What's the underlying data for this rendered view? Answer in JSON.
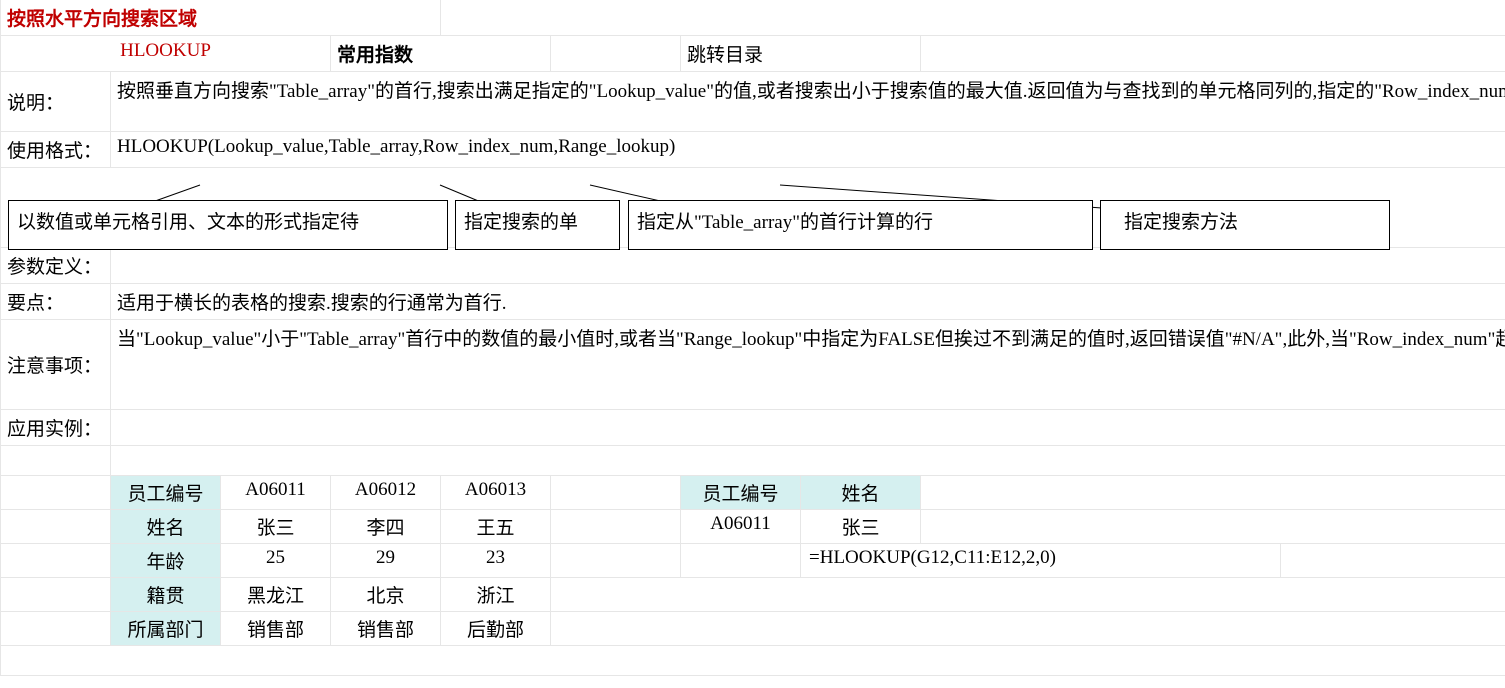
{
  "title": "按照水平方向搜索区域",
  "function_name": "HLOOKUP",
  "freq_label": "常用指数",
  "nav_link": "跳转目录",
  "labels": {
    "desc": "说明：",
    "usage": "使用格式：",
    "params": "参数定义：",
    "points": "要点：",
    "notes": "注意事项：",
    "example": "应用实例："
  },
  "description": "按照垂直方向搜索\"Table_array\"的首行,搜索出满足指定的\"Lookup_value\"的值,或者搜索出小于搜索值的最大值.返回值为与查找到的单元格同列的,指定的\"Row_index_num\"(行序号)下移的单元格的值.",
  "usage_formula": "HLOOKUP(Lookup_value,Table_array,Row_index_num,Range_lookup)",
  "tooltips": {
    "t1": "以数值或单元格引用、文本的形式指定待",
    "t2": "指定搜索的单",
    "t3": "指定从\"Table_array\"的首行计算的行",
    "t4": "指定搜索方法"
  },
  "points_text": "适用于横长的表格的搜索.搜索的行通常为首行.",
  "notes_text": "当\"Lookup_value\"小于\"Table_array\"首行中的数值的最小值时,或者当\"Range_lookup\"中指定为FALSE但挨过不到满足的值时,返回错误值\"#N/A\",此外,当\"Row_index_num\"超出搜索区域的行数时返回错误值\"#REF!\".当\"Row_index_num\"小于1时返回错误值\"#VALUE!\".使用函数时要注意确认参数是否正确.",
  "example_table": {
    "row_headers": [
      "员工编号",
      "姓名",
      "年龄",
      "籍贯",
      "所属部门"
    ],
    "cols": [
      [
        "A06011",
        "张三",
        "25",
        "黑龙江",
        "销售部"
      ],
      [
        "A06012",
        "李四",
        "29",
        "北京",
        "销售部"
      ],
      [
        "A06013",
        "王五",
        "23",
        "浙江",
        "后勤部"
      ]
    ]
  },
  "lookup_table": {
    "headers": [
      "员工编号",
      "姓名"
    ],
    "row": [
      "A06011",
      "张三"
    ],
    "formula": "=HLOOKUP(G12,C11:E12,2,0)"
  }
}
